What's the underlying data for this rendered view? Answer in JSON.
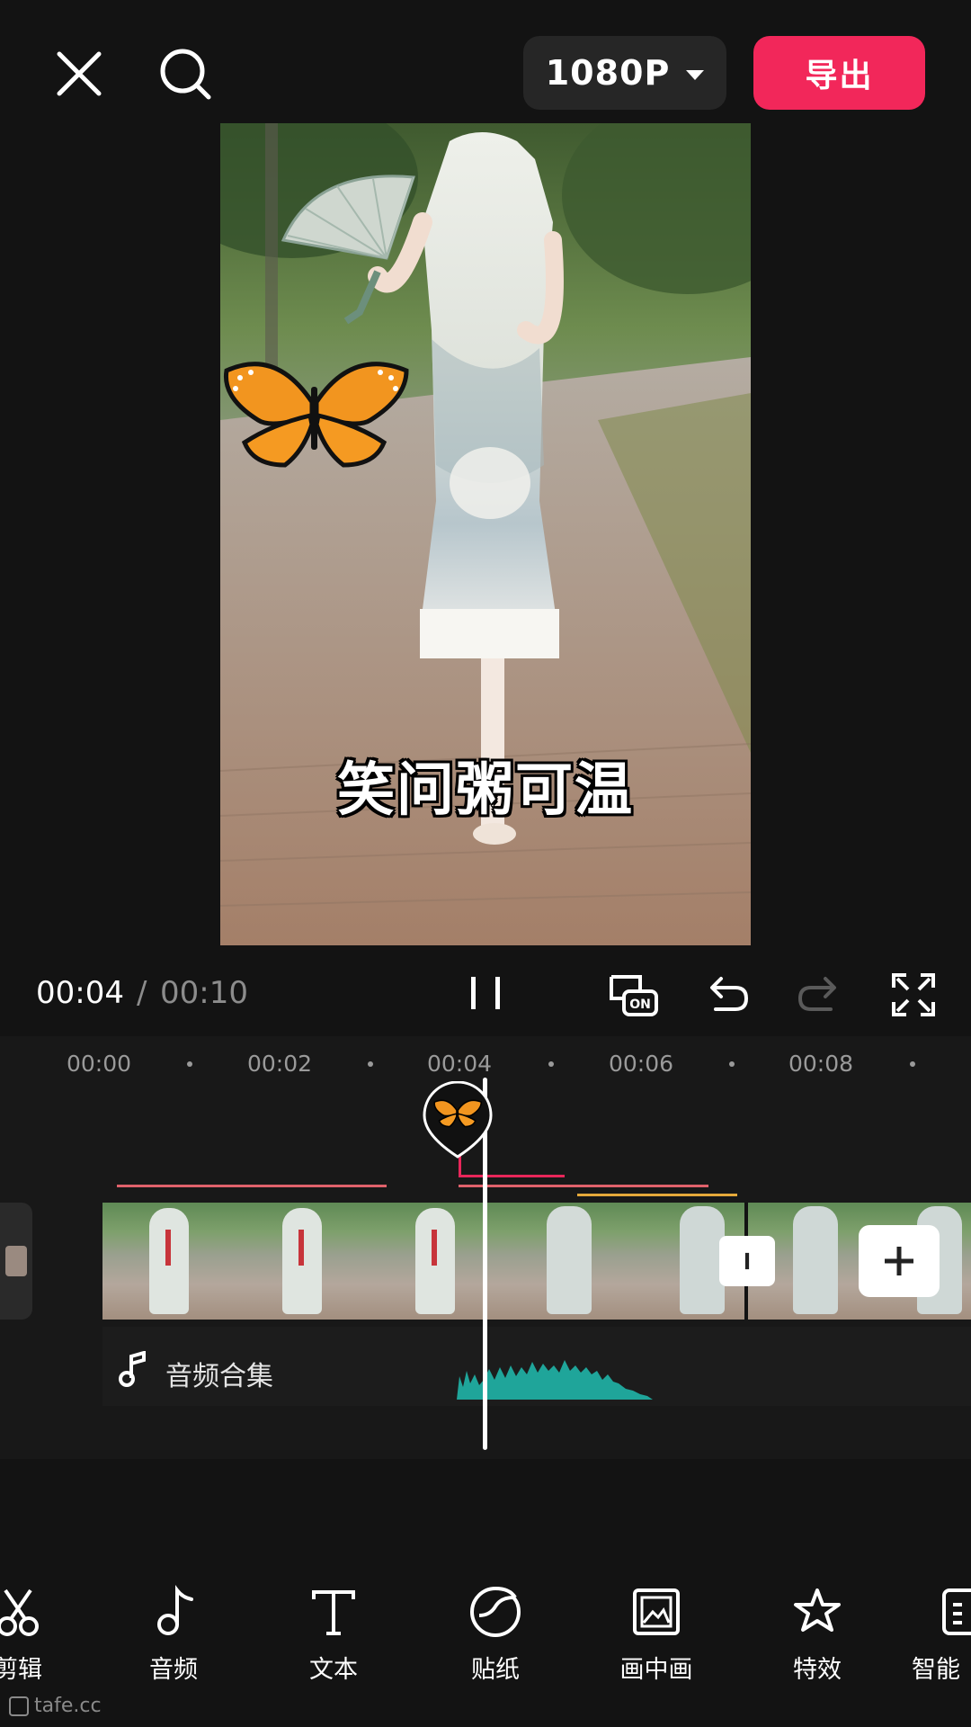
{
  "header": {
    "resolution": "1080P",
    "export_label": "导出"
  },
  "preview": {
    "subtitle": "笑问粥可温"
  },
  "playback": {
    "current_time": "00:04",
    "separator": "/",
    "total_time": "00:10"
  },
  "timeline": {
    "ruler": [
      "00:00",
      "00:02",
      "00:04",
      "00:06",
      "00:08"
    ],
    "audio_track_label": "音频合集"
  },
  "toolbar": {
    "items": [
      {
        "label": "剪辑",
        "icon": "scissors-icon"
      },
      {
        "label": "音频",
        "icon": "music-note-icon"
      },
      {
        "label": "文本",
        "icon": "text-icon"
      },
      {
        "label": "贴纸",
        "icon": "sticker-icon"
      },
      {
        "label": "画中画",
        "icon": "picture-in-picture-icon"
      },
      {
        "label": "特效",
        "icon": "effects-star-icon"
      },
      {
        "label": "智能",
        "icon": "smart-icon"
      }
    ]
  },
  "watermark": "tafe.cc",
  "colors": {
    "accent": "#f2275a",
    "background": "#131313",
    "audio_wave": "#1fa59a",
    "track_line_red": "#e0616b",
    "track_line_yellow": "#e5a93a"
  }
}
